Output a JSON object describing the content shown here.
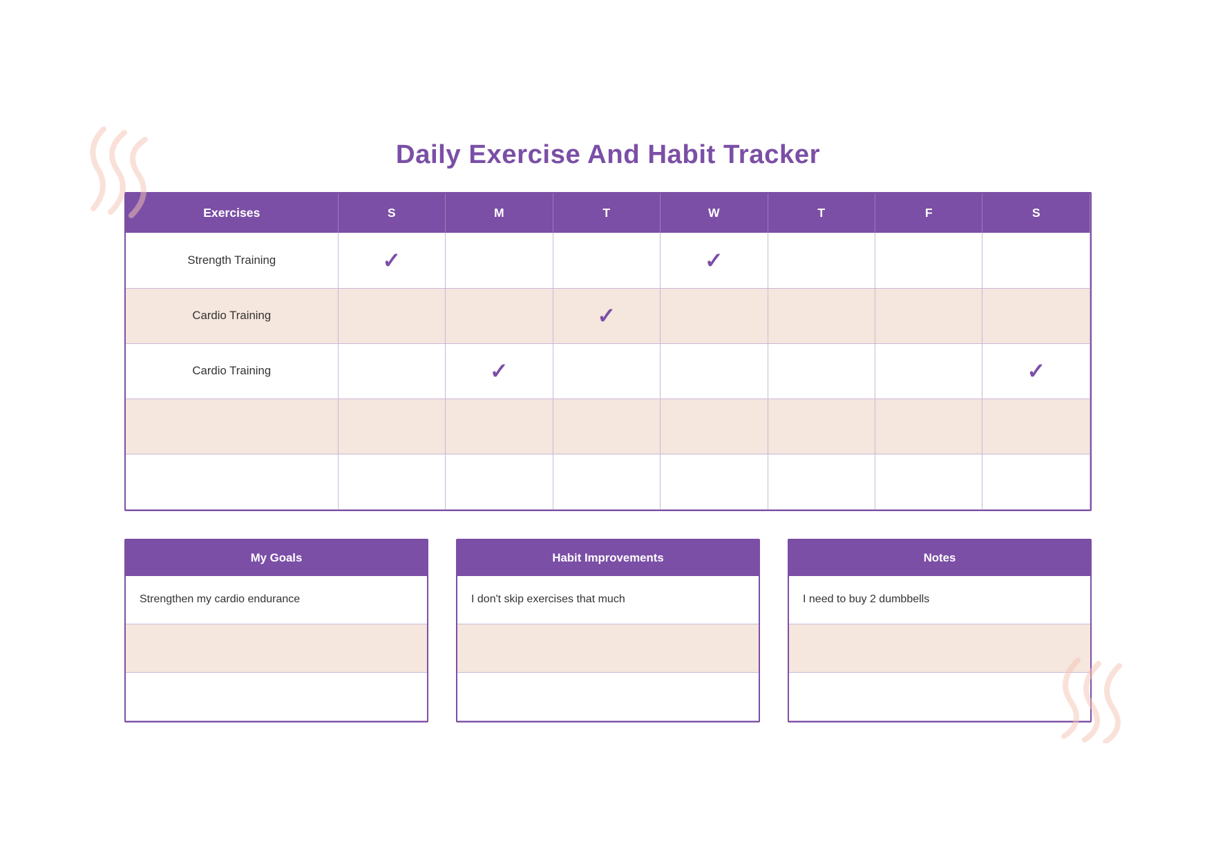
{
  "title": "Daily Exercise And Habit Tracker",
  "table": {
    "headers": [
      "Exercises",
      "S",
      "M",
      "T",
      "W",
      "T",
      "F",
      "S"
    ],
    "rows": [
      {
        "exercise": "Strength Training",
        "days": [
          true,
          false,
          false,
          true,
          false,
          false,
          false
        ]
      },
      {
        "exercise": "Cardio Training",
        "days": [
          false,
          false,
          true,
          false,
          false,
          false,
          false
        ]
      },
      {
        "exercise": "Cardio Training",
        "days": [
          false,
          true,
          false,
          false,
          false,
          false,
          true
        ]
      },
      {
        "exercise": "",
        "days": [
          false,
          false,
          false,
          false,
          false,
          false,
          false
        ]
      },
      {
        "exercise": "",
        "days": [
          false,
          false,
          false,
          false,
          false,
          false,
          false
        ]
      }
    ]
  },
  "goals": {
    "header": "My Goals",
    "rows": [
      "Strengthen my cardio endurance",
      "",
      ""
    ]
  },
  "improvements": {
    "header": "Habit Improvements",
    "rows": [
      "I don't skip exercises that much",
      "",
      ""
    ]
  },
  "notes": {
    "header": "Notes",
    "rows": [
      "I need to buy 2 dumbbells",
      "",
      ""
    ]
  },
  "colors": {
    "purple": "#7b4fa6",
    "peach": "#f5e6de",
    "white": "#ffffff"
  }
}
